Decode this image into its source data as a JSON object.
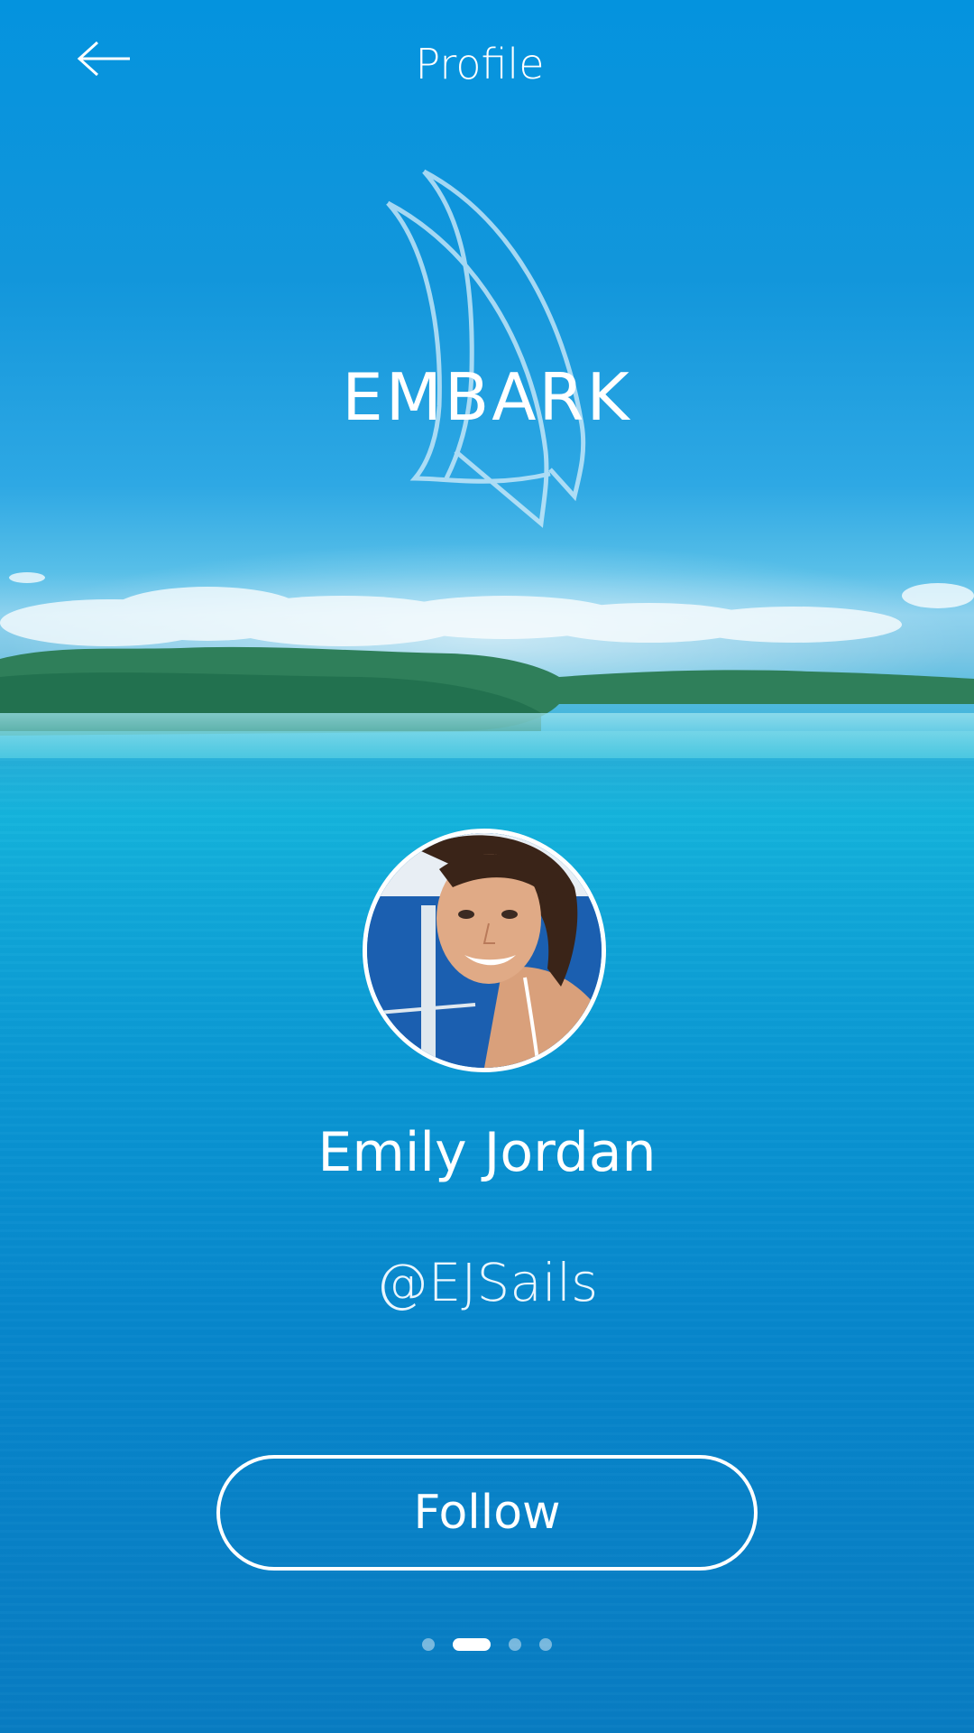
{
  "header": {
    "title": "Profile",
    "back_icon": "arrow-left-icon"
  },
  "brand": {
    "name": "EMBARK",
    "logo_icon": "sail-logo-icon"
  },
  "profile": {
    "name": "Emily Jordan",
    "handle": "@EJSails"
  },
  "actions": {
    "follow_label": "Follow"
  },
  "pager": {
    "count": 4,
    "active_index": 1
  },
  "colors": {
    "accent": "#ffffff",
    "sky_top": "#0493de",
    "water": "#0a97d3"
  }
}
